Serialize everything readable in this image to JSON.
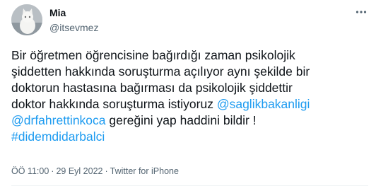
{
  "author": {
    "name": "Mia",
    "handle": "@itsevmez",
    "avatar_icon": "cat-avatar-icon"
  },
  "more_icon": "more-options-icon",
  "tweet": {
    "line1": "Bir öğretmen öğrencisine bağırdığı zaman psikolojik",
    "line2": "şiddetten hakkında soruşturma açılıyor aynı şekilde bir",
    "line3": "doktorun hastasına bağırması da psikolojik şiddettir",
    "line4_text": "doktor hakkında soruşturma istiyoruz ",
    "mention1": "@saglikbakanligi",
    "mention2": "@drfahrettinkoca",
    "line5_text": " gereğini yap haddini bildir !",
    "hashtag": "#didemdidarbalci"
  },
  "meta": {
    "time": "ÖÖ 11:00",
    "separator": "·",
    "date": "29 Eyl 2022",
    "source": "Twitter for iPhone"
  },
  "colors": {
    "link": "#1d9bf0",
    "text": "#0f1419",
    "secondary": "#536471"
  }
}
